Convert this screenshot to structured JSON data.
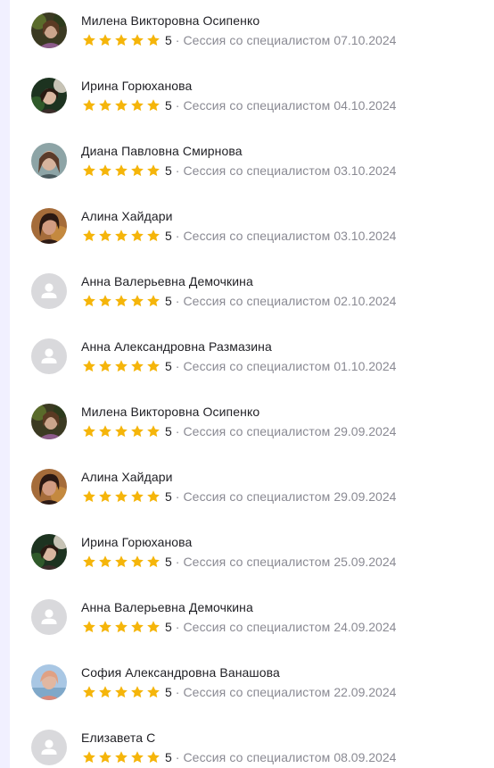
{
  "colors": {
    "star": "#f5b50a",
    "name_text": "#1f1f24",
    "muted_text": "#8a8a93",
    "placeholder_avatar_bg": "#d9d9dc",
    "placeholder_avatar_fg": "#ffffff",
    "left_rail": "#f1f0ff"
  },
  "reviews": [
    {
      "name": "Милена Викторовна Осипенко",
      "rating": 5,
      "rating_label": "5",
      "session_label": "Сессия со специалистом",
      "date": "07.10.2024",
      "avatar": "photo-1"
    },
    {
      "name": "Ирина Горюханова",
      "rating": 5,
      "rating_label": "5",
      "session_label": "Сессия со специалистом",
      "date": "04.10.2024",
      "avatar": "photo-2"
    },
    {
      "name": "Диана Павловна Смирнова",
      "rating": 5,
      "rating_label": "5",
      "session_label": "Сессия со специалистом",
      "date": "03.10.2024",
      "avatar": "photo-3"
    },
    {
      "name": "Алина Хайдари",
      "rating": 5,
      "rating_label": "5",
      "session_label": "Сессия со специалистом",
      "date": "03.10.2024",
      "avatar": "photo-4"
    },
    {
      "name": "Анна Валерьевна Демочкина",
      "rating": 5,
      "rating_label": "5",
      "session_label": "Сессия со специалистом",
      "date": "02.10.2024",
      "avatar": "placeholder"
    },
    {
      "name": "Анна Александровна Размазина",
      "rating": 5,
      "rating_label": "5",
      "session_label": "Сессия со специалистом",
      "date": "01.10.2024",
      "avatar": "placeholder"
    },
    {
      "name": "Милена Викторовна Осипенко",
      "rating": 5,
      "rating_label": "5",
      "session_label": "Сессия со специалистом",
      "date": "29.09.2024",
      "avatar": "photo-1"
    },
    {
      "name": "Алина Хайдари",
      "rating": 5,
      "rating_label": "5",
      "session_label": "Сессия со специалистом",
      "date": "29.09.2024",
      "avatar": "photo-4"
    },
    {
      "name": "Ирина Горюханова",
      "rating": 5,
      "rating_label": "5",
      "session_label": "Сессия со специалистом",
      "date": "25.09.2024",
      "avatar": "photo-2"
    },
    {
      "name": "Анна Валерьевна Демочкина",
      "rating": 5,
      "rating_label": "5",
      "session_label": "Сессия со специалистом",
      "date": "24.09.2024",
      "avatar": "placeholder"
    },
    {
      "name": "София Александровна Ванашова",
      "rating": 5,
      "rating_label": "5",
      "session_label": "Сессия со специалистом",
      "date": "22.09.2024",
      "avatar": "photo-5"
    },
    {
      "name": "Елизавета С",
      "rating": 5,
      "rating_label": "5",
      "session_label": "Сессия со специалистом",
      "date": "08.09.2024",
      "avatar": "placeholder"
    }
  ]
}
